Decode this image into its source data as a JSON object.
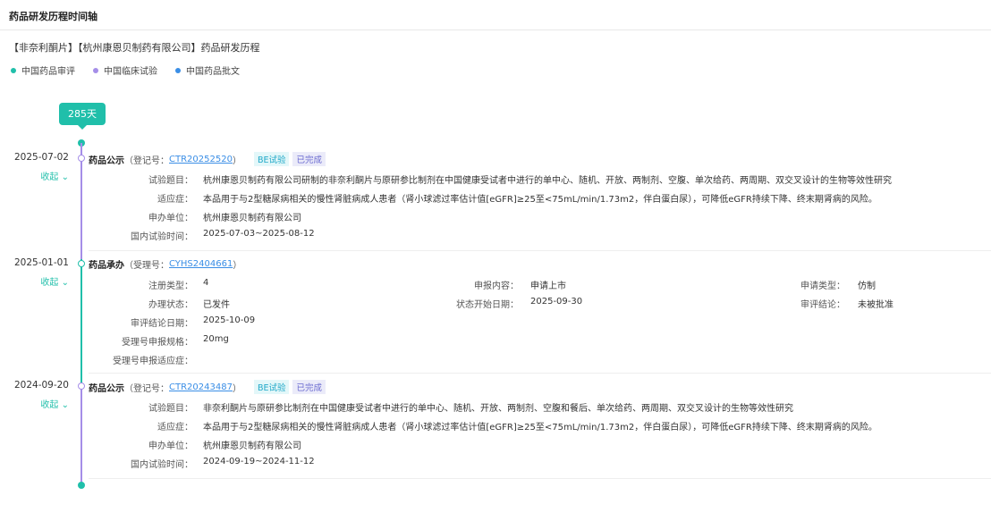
{
  "header": {
    "title": "药品研发历程时间轴"
  },
  "subtitle": "【非奈利酮片】【杭州康恩贝制药有限公司】药品研发历程",
  "legend": [
    {
      "label": "中国药品审评",
      "color": "#20bfaa"
    },
    {
      "label": "中国临床试验",
      "color": "#a58ee8"
    },
    {
      "label": "中国药品批文",
      "color": "#3a8ee6"
    }
  ],
  "duration_badge": "285天",
  "collapse_label": "收起",
  "entries": [
    {
      "date": "2025-07-02",
      "type": "药品公示",
      "id_label": "（登记号：",
      "id": "CTR20252520",
      "id_close": "）",
      "tags": [
        "BE试验",
        "已完成"
      ],
      "color": "#a58ee8",
      "fields": [
        {
          "label": "试验题目：",
          "value": "杭州康恩贝制药有限公司研制的非奈利酮片与原研参比制剂在中国健康受试者中进行的单中心、随机、开放、两制剂、空腹、单次给药、两周期、双交叉设计的生物等效性研究"
        },
        {
          "label": "适应症：",
          "value": "本品用于与2型糖尿病相关的慢性肾脏病成人患者（肾小球滤过率估计值[eGFR]≥25至<75mL/min/1.73m2，伴白蛋白尿），可降低eGFR持续下降、终末期肾病的风险。"
        },
        {
          "label": "申办单位：",
          "value": "杭州康恩贝制药有限公司"
        },
        {
          "label": "国内试验时间：",
          "value": "2025-07-03~2025-08-12"
        }
      ]
    },
    {
      "date": "2025-01-01",
      "type": "药品承办",
      "id_label": "（受理号：",
      "id": "CYHS2404661",
      "id_close": "）",
      "color": "#20bfaa",
      "fields": [
        {
          "label": "注册类型：",
          "value": "4"
        },
        {
          "label": "申报内容：",
          "value": "申请上市"
        },
        {
          "label": "申请类型：",
          "value": "仿制"
        },
        {
          "label": "办理状态：",
          "value": "已发件"
        },
        {
          "label": "状态开始日期：",
          "value": "2025-09-30"
        },
        {
          "label": "审评结论：",
          "value": "未被批准"
        },
        {
          "label": "审评结论日期：",
          "value": "2025-10-09"
        },
        {
          "label": "受理号申报规格：",
          "value": "20mg"
        },
        {
          "label": "受理号申报适应症：",
          "value": ""
        }
      ]
    },
    {
      "date": "2024-09-20",
      "type": "药品公示",
      "id_label": "（登记号：",
      "id": "CTR20243487",
      "id_close": "）",
      "tags": [
        "BE试验",
        "已完成"
      ],
      "color": "#a58ee8",
      "fields": [
        {
          "label": "试验题目：",
          "value": "非奈利酮片与原研参比制剂在中国健康受试者中进行的单中心、随机、开放、两制剂、空腹和餐后、单次给药、两周期、双交叉设计的生物等效性研究"
        },
        {
          "label": "适应症：",
          "value": "本品用于与2型糖尿病相关的慢性肾脏病成人患者（肾小球滤过率估计值[eGFR]≥25至<75mL/min/1.73m2，伴白蛋白尿），可降低eGFR持续下降、终末期肾病的风险。"
        },
        {
          "label": "申办单位：",
          "value": "杭州康恩贝制药有限公司"
        },
        {
          "label": "国内试验时间：",
          "value": "2024-09-19~2024-11-12"
        }
      ]
    }
  ]
}
